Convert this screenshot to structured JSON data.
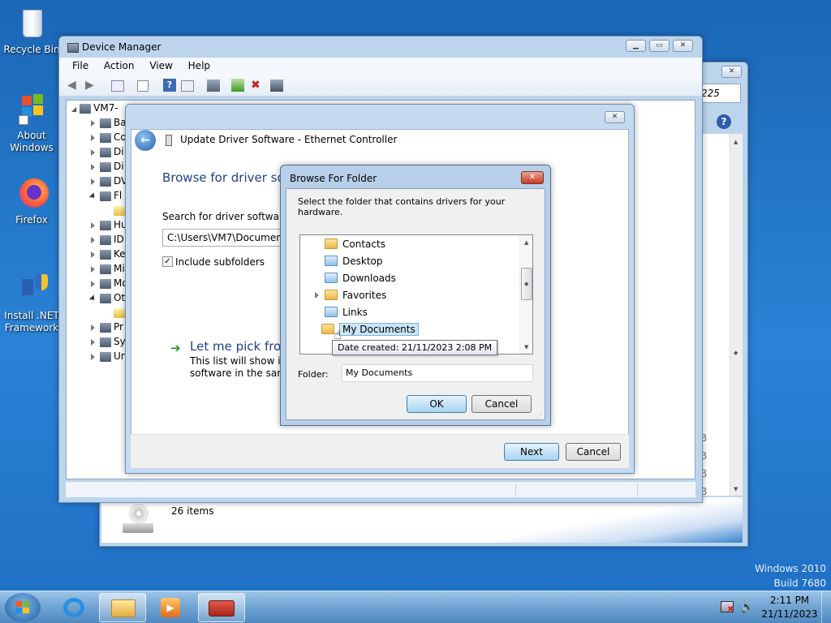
{
  "desktop": {
    "icons": [
      {
        "label": "Recycle Bin"
      },
      {
        "label": "About Windows"
      },
      {
        "label": "Firefox"
      },
      {
        "label": "Install .NET Framework"
      }
    ],
    "watermark_line1": "Windows 2010",
    "watermark_line2": "Build 7680"
  },
  "back_window": {
    "address_fragment": "225",
    "items_count": "26 items",
    "col_fragments": [
      "B",
      "B",
      "B",
      "B"
    ]
  },
  "device_manager": {
    "title": "Device Manager",
    "menu": [
      "File",
      "Action",
      "View",
      "Help"
    ],
    "tree_root": "VM7-",
    "tree_items": [
      "Ba",
      "Co",
      "Di",
      "Di",
      "DV",
      "Fl",
      "",
      "Hu",
      "ID",
      "Ke",
      "Mi",
      "Mo",
      "Ot",
      "",
      "Pr",
      "Sy",
      "Un"
    ]
  },
  "update_driver": {
    "title": "Update Driver Software - Ethernet Controller",
    "heading": "Browse for driver sof",
    "search_label": "Search for driver software in",
    "path_value": "C:\\Users\\VM7\\Documents",
    "include_subfolders": "Include subfolders",
    "pick_title": "Let me pick from",
    "pick_desc1": "This list will show inst",
    "pick_desc2": "software in the same",
    "next": "Next",
    "cancel": "Cancel"
  },
  "browse_folder": {
    "title": "Browse For Folder",
    "instruction": "Select the folder that contains drivers for your hardware.",
    "folders": [
      "Contacts",
      "Desktop",
      "Downloads",
      "Favorites",
      "Links",
      "My Documents"
    ],
    "selected": "My Documents",
    "tooltip": "Date created: 21/11/2023 2:08 PM",
    "folder_label": "Folder:",
    "folder_value": "My Documents",
    "ok": "OK",
    "cancel": "Cancel"
  },
  "taskbar": {
    "time": "2:11 PM",
    "date": "21/11/2023"
  }
}
